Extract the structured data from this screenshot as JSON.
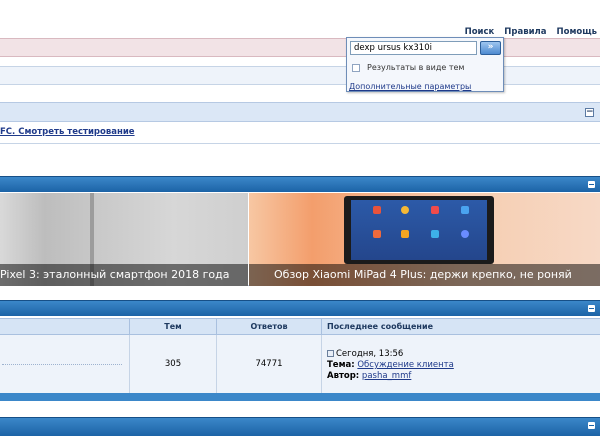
{
  "toplinks": {
    "search": "Поиск",
    "rules": "Правила",
    "help": "Помощь"
  },
  "search_popup": {
    "value": "dexp ursus kx310i",
    "go_label": "»",
    "checkbox_label": "Результаты в виде тем",
    "advanced_link": "Дополнительные параметры"
  },
  "news": {
    "link": "FC. Смотреть тестирование"
  },
  "slider": {
    "slides": [
      {
        "caption": "Pixel 3: эталонный смартфон 2018 года"
      },
      {
        "caption": "Обзор Xiaomi MiPad 4 Plus: держи крепко, не роняй"
      }
    ]
  },
  "forum_table": {
    "headers": {
      "topics": "Тем",
      "replies": "Ответов",
      "last_post": "Последнее сообщение"
    },
    "row": {
      "topics": "305",
      "replies": "74771",
      "last_date": "Сегодня, 13:56",
      "topic_label": "Тема:",
      "topic_link": "Обсуждение клиента",
      "author_label": "Автор:",
      "author_link": "pasha_mmf"
    }
  },
  "colors": {
    "accent_blue": "#1c63a6",
    "header_light": "#d6e4f5",
    "row_bg": "#eef3fa"
  }
}
